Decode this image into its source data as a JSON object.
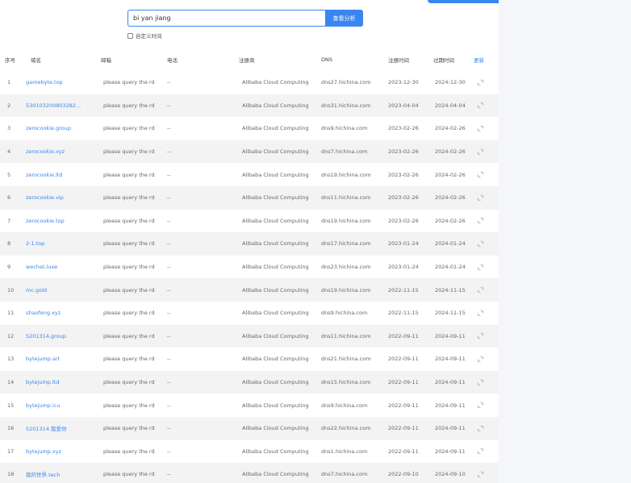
{
  "search": {
    "value": "bi yan jiang",
    "button_label": "查看分析",
    "custom_time_label": "自定义时间"
  },
  "table": {
    "headers": {
      "no": "序号",
      "domain": "域名",
      "email": "邮箱",
      "phone": "电话",
      "registrar": "注册商",
      "dns": "DNS",
      "reg_time": "注册时间",
      "exp_time": "过期时间",
      "refresh": "更新"
    },
    "rows": [
      {
        "no": "1",
        "domain": "gamebyte.top",
        "email": "please query the rd",
        "phone": "--",
        "registrar": "Alibaba Cloud Computing",
        "dns": "dns27.hichina.com",
        "reg": "2023-12-30",
        "exp": "2024-12-30"
      },
      {
        "no": "2",
        "domain": "530103200803282...",
        "email": "please query the rd",
        "phone": "--",
        "registrar": "Alibaba Cloud Computing",
        "dns": "dns31.hichina.com",
        "reg": "2023-04-04",
        "exp": "2024-04-04"
      },
      {
        "no": "3",
        "domain": "zerocookie.group",
        "email": "please query the rd",
        "phone": "--",
        "registrar": "Alibaba Cloud Computing",
        "dns": "dns9.hichina.com",
        "reg": "2023-02-26",
        "exp": "2024-02-26"
      },
      {
        "no": "4",
        "domain": "zerocookie.xyz",
        "email": "please query the rd",
        "phone": "--",
        "registrar": "Alibaba Cloud Computing",
        "dns": "dns7.hichina.com",
        "reg": "2023-02-26",
        "exp": "2024-02-26"
      },
      {
        "no": "5",
        "domain": "zerocookie.ltd",
        "email": "please query the rd",
        "phone": "--",
        "registrar": "Alibaba Cloud Computing",
        "dns": "dns19.hichina.com",
        "reg": "2023-02-26",
        "exp": "2024-02-26"
      },
      {
        "no": "6",
        "domain": "zerocookie.vip",
        "email": "please query the rd",
        "phone": "--",
        "registrar": "Alibaba Cloud Computing",
        "dns": "dns11.hichina.com",
        "reg": "2023-02-26",
        "exp": "2024-02-26"
      },
      {
        "no": "7",
        "domain": "zerocookie.top",
        "email": "please query the rd",
        "phone": "--",
        "registrar": "Alibaba Cloud Computing",
        "dns": "dns19.hichina.com",
        "reg": "2023-02-26",
        "exp": "2024-02-26"
      },
      {
        "no": "8",
        "domain": "2-1.top",
        "email": "please query the rd",
        "phone": "--",
        "registrar": "Alibaba Cloud Computing",
        "dns": "dns17.hichina.com",
        "reg": "2023-01-24",
        "exp": "2024-01-24"
      },
      {
        "no": "9",
        "domain": "wechat.luxe",
        "email": "please query the rd",
        "phone": "--",
        "registrar": "Alibaba Cloud Computing",
        "dns": "dns23.hichina.com",
        "reg": "2023-01-24",
        "exp": "2024-01-24"
      },
      {
        "no": "10",
        "domain": "mc.gold",
        "email": "please query the rd",
        "phone": "--",
        "registrar": "Alibaba Cloud Computing",
        "dns": "dns19.hichina.com",
        "reg": "2022-11-15",
        "exp": "2024-11-15"
      },
      {
        "no": "11",
        "domain": "shaofeng.xyz",
        "email": "please query the rd",
        "phone": "--",
        "registrar": "Alibaba Cloud Computing",
        "dns": "dns9.hichina.com",
        "reg": "2022-11-15",
        "exp": "2024-11-15"
      },
      {
        "no": "12",
        "domain": "5201314.group",
        "email": "please query the rd",
        "phone": "--",
        "registrar": "Alibaba Cloud Computing",
        "dns": "dns11.hichina.com",
        "reg": "2022-09-11",
        "exp": "2024-09-11"
      },
      {
        "no": "13",
        "domain": "bytejump.art",
        "email": "please query the rd",
        "phone": "--",
        "registrar": "Alibaba Cloud Computing",
        "dns": "dns21.hichina.com",
        "reg": "2022-09-11",
        "exp": "2024-09-11"
      },
      {
        "no": "14",
        "domain": "bytejump.ltd",
        "email": "please query the rd",
        "phone": "--",
        "registrar": "Alibaba Cloud Computing",
        "dns": "dns15.hichina.com",
        "reg": "2022-09-11",
        "exp": "2024-09-11"
      },
      {
        "no": "15",
        "domain": "bytejump.icu",
        "email": "please query the rd",
        "phone": "--",
        "registrar": "Alibaba Cloud Computing",
        "dns": "dns9.hichina.com",
        "reg": "2022-09-11",
        "exp": "2024-09-11"
      },
      {
        "no": "16",
        "domain": "5201314.我爱你",
        "email": "please query the rd",
        "phone": "--",
        "registrar": "Alibaba Cloud Computing",
        "dns": "dns22.hichina.com",
        "reg": "2022-09-11",
        "exp": "2024-09-11"
      },
      {
        "no": "17",
        "domain": "bytejump.xyz",
        "email": "please query the rd",
        "phone": "--",
        "registrar": "Alibaba Cloud Computing",
        "dns": "dns1.hichina.com",
        "reg": "2022-09-11",
        "exp": "2024-09-11"
      },
      {
        "no": "18",
        "domain": "我的世界.tech",
        "email": "please query the rd",
        "phone": "--",
        "registrar": "Alibaba Cloud Computing",
        "dns": "dns7.hichina.com",
        "reg": "2022-09-10",
        "exp": "2024-09-10"
      }
    ]
  },
  "icons": {
    "refresh": "refresh-icon"
  },
  "colors": {
    "accent": "#3a86f0",
    "row_stripe": "#f3f3f3"
  }
}
